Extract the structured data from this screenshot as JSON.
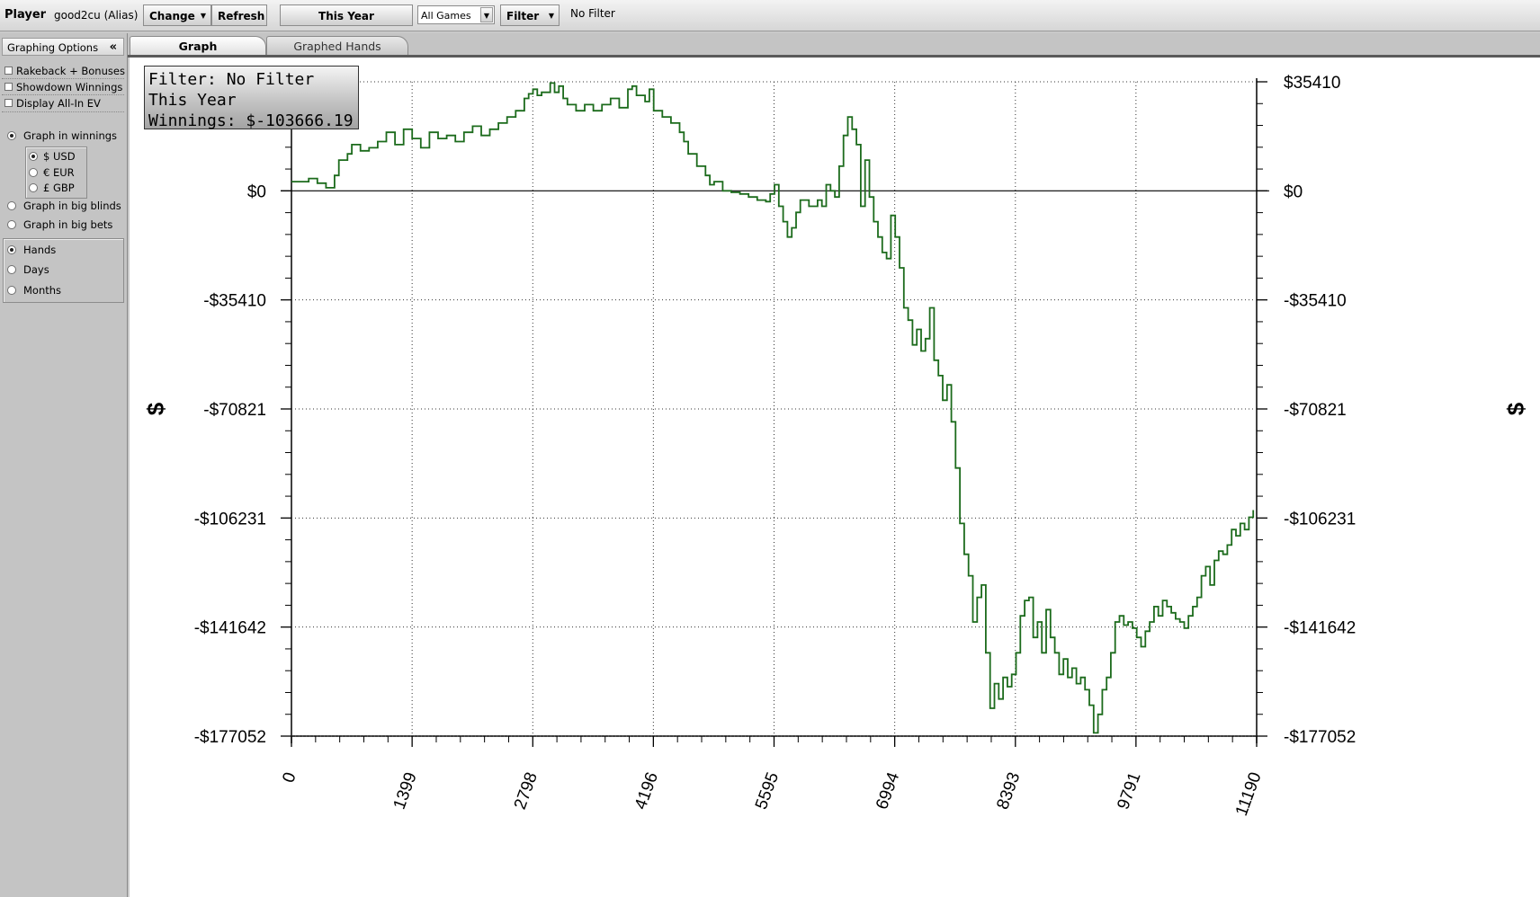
{
  "toolbar": {
    "player_label": "Player",
    "alias": "good2cu (Alias)",
    "change_label": "Change",
    "refresh_label": "Refresh",
    "period_label": "This Year",
    "games_value": "All Games",
    "filter_label": "Filter",
    "filter_status": "No Filter"
  },
  "sidebar": {
    "header": "Graphing Options",
    "collapse_glyph": "«",
    "checkboxes": [
      {
        "label": "Rakeback + Bonuses",
        "checked": false
      },
      {
        "label": "Showdown Winnings",
        "checked": false
      },
      {
        "label": "Display All-In EV",
        "checked": false
      }
    ],
    "graph_modes": [
      {
        "label": "Graph in winnings",
        "selected": true
      },
      {
        "label": "Graph in big blinds",
        "selected": false
      },
      {
        "label": "Graph in big bets",
        "selected": false
      }
    ],
    "currencies": [
      {
        "label": "$ USD",
        "selected": true
      },
      {
        "label": "€ EUR",
        "selected": false
      },
      {
        "label": "£ GBP",
        "selected": false
      }
    ],
    "x_units": [
      {
        "label": "Hands",
        "selected": true
      },
      {
        "label": "Days",
        "selected": false
      },
      {
        "label": "Months",
        "selected": false
      }
    ]
  },
  "tabs": [
    {
      "label": "Graph",
      "active": true
    },
    {
      "label": "Graphed Hands",
      "active": false
    }
  ],
  "info_box": {
    "line1": "Filter: No Filter",
    "line2": "This Year",
    "line3": "Winnings: $-103666.19"
  },
  "chart_data": {
    "type": "line",
    "ylabel": "$",
    "y_ticks": [
      35410,
      0,
      -35410,
      -70821,
      -106231,
      -141642,
      -177052
    ],
    "y_tick_labels": [
      "$35410",
      "$0",
      "-$35410",
      "-$70821",
      "-$106231",
      "-$141642",
      "-$177052"
    ],
    "x_ticks": [
      0,
      1399,
      2798,
      4196,
      5595,
      6994,
      8393,
      9791,
      11190
    ],
    "x_tick_labels": [
      "0",
      "1399",
      "2798",
      "4196",
      "5595",
      "6994",
      "8393",
      "9791",
      "11190"
    ],
    "xlim": [
      0,
      11190
    ],
    "ylim": [
      -177052,
      35410
    ],
    "grid": true,
    "series": [
      {
        "color": "#1c6b1c",
        "points": [
          [
            0,
            3000
          ],
          [
            200,
            4000
          ],
          [
            300,
            2500
          ],
          [
            400,
            1000
          ],
          [
            500,
            5000
          ],
          [
            550,
            10000
          ],
          [
            650,
            12000
          ],
          [
            700,
            15000
          ],
          [
            800,
            13000
          ],
          [
            900,
            14000
          ],
          [
            1000,
            16000
          ],
          [
            1100,
            19000
          ],
          [
            1200,
            15000
          ],
          [
            1300,
            20000
          ],
          [
            1400,
            17000
          ],
          [
            1500,
            14000
          ],
          [
            1600,
            19000
          ],
          [
            1700,
            17000
          ],
          [
            1800,
            18000
          ],
          [
            1900,
            16000
          ],
          [
            2000,
            19000
          ],
          [
            2100,
            21000
          ],
          [
            2200,
            18000
          ],
          [
            2300,
            20000
          ],
          [
            2400,
            22000
          ],
          [
            2500,
            24000
          ],
          [
            2600,
            26000
          ],
          [
            2700,
            30000
          ],
          [
            2750,
            31500
          ],
          [
            2800,
            33000
          ],
          [
            2850,
            31000
          ],
          [
            2900,
            32000
          ],
          [
            3000,
            35000
          ],
          [
            3050,
            32000
          ],
          [
            3100,
            34000
          ],
          [
            3150,
            30000
          ],
          [
            3200,
            28000
          ],
          [
            3300,
            26000
          ],
          [
            3400,
            28000
          ],
          [
            3500,
            26000
          ],
          [
            3600,
            28000
          ],
          [
            3700,
            30000
          ],
          [
            3800,
            27000
          ],
          [
            3900,
            33000
          ],
          [
            3950,
            34000
          ],
          [
            4000,
            31000
          ],
          [
            4100,
            29000
          ],
          [
            4150,
            33000
          ],
          [
            4200,
            26000
          ],
          [
            4300,
            24000
          ],
          [
            4400,
            22000
          ],
          [
            4500,
            19000
          ],
          [
            4550,
            16000
          ],
          [
            4600,
            12000
          ],
          [
            4700,
            8000
          ],
          [
            4800,
            5000
          ],
          [
            4850,
            2000
          ],
          [
            4900,
            3000
          ],
          [
            5000,
            0
          ],
          [
            5100,
            -500
          ],
          [
            5200,
            -1000
          ],
          [
            5300,
            -2000
          ],
          [
            5400,
            -3000
          ],
          [
            5500,
            -3500
          ],
          [
            5550,
            -1000
          ],
          [
            5600,
            2000
          ],
          [
            5650,
            -5000
          ],
          [
            5700,
            -10000
          ],
          [
            5750,
            -15000
          ],
          [
            5800,
            -12000
          ],
          [
            5850,
            -7000
          ],
          [
            5900,
            -3000
          ],
          [
            6000,
            -5000
          ],
          [
            6100,
            -3000
          ],
          [
            6150,
            -5000
          ],
          [
            6200,
            2000
          ],
          [
            6250,
            0
          ],
          [
            6300,
            -2000
          ],
          [
            6350,
            8000
          ],
          [
            6400,
            18000
          ],
          [
            6450,
            24000
          ],
          [
            6500,
            20000
          ],
          [
            6550,
            15000
          ],
          [
            6600,
            -5000
          ],
          [
            6650,
            10000
          ],
          [
            6700,
            -2000
          ],
          [
            6750,
            -10000
          ],
          [
            6800,
            -15000
          ],
          [
            6850,
            -20000
          ],
          [
            6900,
            -22000
          ],
          [
            6950,
            -8000
          ],
          [
            7000,
            -15000
          ],
          [
            7050,
            -25000
          ],
          [
            7100,
            -38000
          ],
          [
            7150,
            -42000
          ],
          [
            7200,
            -50000
          ],
          [
            7250,
            -45000
          ],
          [
            7300,
            -52000
          ],
          [
            7350,
            -48000
          ],
          [
            7400,
            -38000
          ],
          [
            7450,
            -55000
          ],
          [
            7500,
            -60000
          ],
          [
            7550,
            -68000
          ],
          [
            7600,
            -63000
          ],
          [
            7650,
            -75000
          ],
          [
            7700,
            -90000
          ],
          [
            7750,
            -108000
          ],
          [
            7800,
            -118000
          ],
          [
            7850,
            -125000
          ],
          [
            7900,
            -140000
          ],
          [
            7950,
            -132000
          ],
          [
            8000,
            -128000
          ],
          [
            8050,
            -150000
          ],
          [
            8100,
            -168000
          ],
          [
            8150,
            -160000
          ],
          [
            8200,
            -165000
          ],
          [
            8250,
            -158000
          ],
          [
            8300,
            -161000
          ],
          [
            8350,
            -157000
          ],
          [
            8400,
            -150000
          ],
          [
            8450,
            -138000
          ],
          [
            8500,
            -133000
          ],
          [
            8550,
            -132000
          ],
          [
            8600,
            -145000
          ],
          [
            8650,
            -140000
          ],
          [
            8700,
            -150000
          ],
          [
            8750,
            -136000
          ],
          [
            8800,
            -145000
          ],
          [
            8850,
            -150000
          ],
          [
            8900,
            -157000
          ],
          [
            8950,
            -152000
          ],
          [
            9000,
            -158000
          ],
          [
            9050,
            -155000
          ],
          [
            9100,
            -160000
          ],
          [
            9150,
            -158000
          ],
          [
            9200,
            -162000
          ],
          [
            9250,
            -167000
          ],
          [
            9300,
            -176000
          ],
          [
            9350,
            -170000
          ],
          [
            9400,
            -162000
          ],
          [
            9450,
            -158000
          ],
          [
            9500,
            -150000
          ],
          [
            9550,
            -140000
          ],
          [
            9600,
            -138000
          ],
          [
            9650,
            -141000
          ],
          [
            9700,
            -140000
          ],
          [
            9750,
            -142000
          ],
          [
            9800,
            -145000
          ],
          [
            9850,
            -148000
          ],
          [
            9900,
            -143000
          ],
          [
            9950,
            -140000
          ],
          [
            10000,
            -135000
          ],
          [
            10050,
            -138000
          ],
          [
            10100,
            -133000
          ],
          [
            10150,
            -135000
          ],
          [
            10200,
            -137000
          ],
          [
            10250,
            -139000
          ],
          [
            10300,
            -140000
          ],
          [
            10350,
            -142000
          ],
          [
            10400,
            -138000
          ],
          [
            10450,
            -135000
          ],
          [
            10500,
            -132000
          ],
          [
            10550,
            -125000
          ],
          [
            10600,
            -122000
          ],
          [
            10650,
            -128000
          ],
          [
            10700,
            -120000
          ],
          [
            10750,
            -117000
          ],
          [
            10800,
            -118000
          ],
          [
            10850,
            -115000
          ],
          [
            10900,
            -110000
          ],
          [
            10950,
            -112000
          ],
          [
            11000,
            -108000
          ],
          [
            11050,
            -110000
          ],
          [
            11100,
            -106000
          ],
          [
            11150,
            -103666
          ]
        ]
      }
    ]
  }
}
